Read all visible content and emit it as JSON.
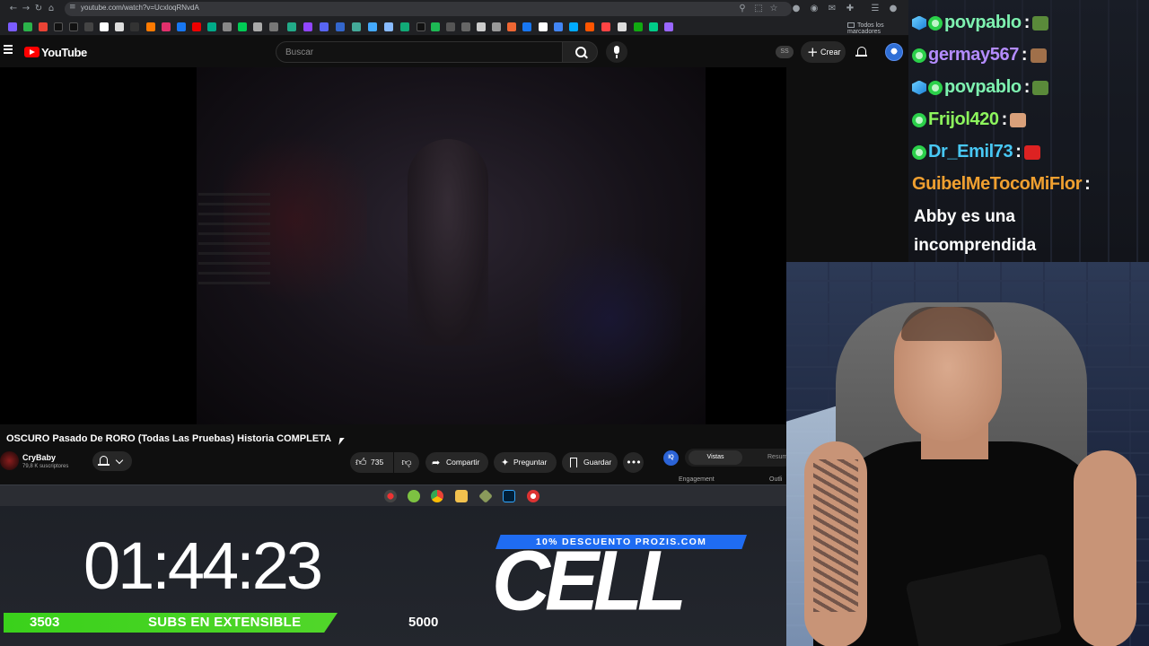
{
  "browser": {
    "url": "youtube.com/watch?v=UcxloqRNvdA",
    "bookmarks_folder": "Todos los marcadores"
  },
  "youtube": {
    "logo_text": "YouTube",
    "search_placeholder": "Buscar",
    "ss_badge": "SS",
    "create_label": "Crear",
    "video_title": "OSCURO Pasado De RORO (Todas Las Pruebas) Historia COMPLETA",
    "channel_name": "CryBaby",
    "channel_subs": "79,8 K suscriptores",
    "like_count": "735",
    "share_label": "Compartir",
    "ask_label": "Preguntar",
    "save_label": "Guardar",
    "extension": {
      "tab_active": "Vistas",
      "tab_other": "Resum",
      "section_left": "Engagement",
      "section_right": "Outli"
    }
  },
  "stream": {
    "timer": "01:44:23",
    "subs_current": "3503",
    "subs_label": "SUBS EN EXTENSIBLE",
    "subs_goal": "5000",
    "subs_progress_fraction": 0.7,
    "promo_tag": "10% DESCUENTO PROZIS.COM",
    "brand": "CELL"
  },
  "chat": {
    "messages": [
      {
        "user": "povpablo",
        "color": "#7ef2b0",
        "badges": [
          "cube",
          "green"
        ]
      },
      {
        "user": "germay567",
        "color": "#b48cff",
        "badges": [
          "green"
        ]
      },
      {
        "user": "povpablo",
        "color": "#7ef2b0",
        "badges": [
          "cube",
          "green"
        ]
      },
      {
        "user": "Frijol420",
        "color": "#8df55d",
        "badges": [
          "green"
        ]
      },
      {
        "user": "Dr_Emil73",
        "color": "#48c8f5",
        "badges": [
          "green"
        ]
      },
      {
        "user": "GuibelMeTocoMiFlor",
        "color": "#f0a030",
        "badges": []
      }
    ],
    "last_message": "Abby es una incomprendida"
  },
  "colors": {
    "youtube_red": "#ff0000",
    "subbar_green": "#3ad11b",
    "promo_blue": "#1f6cf2"
  }
}
